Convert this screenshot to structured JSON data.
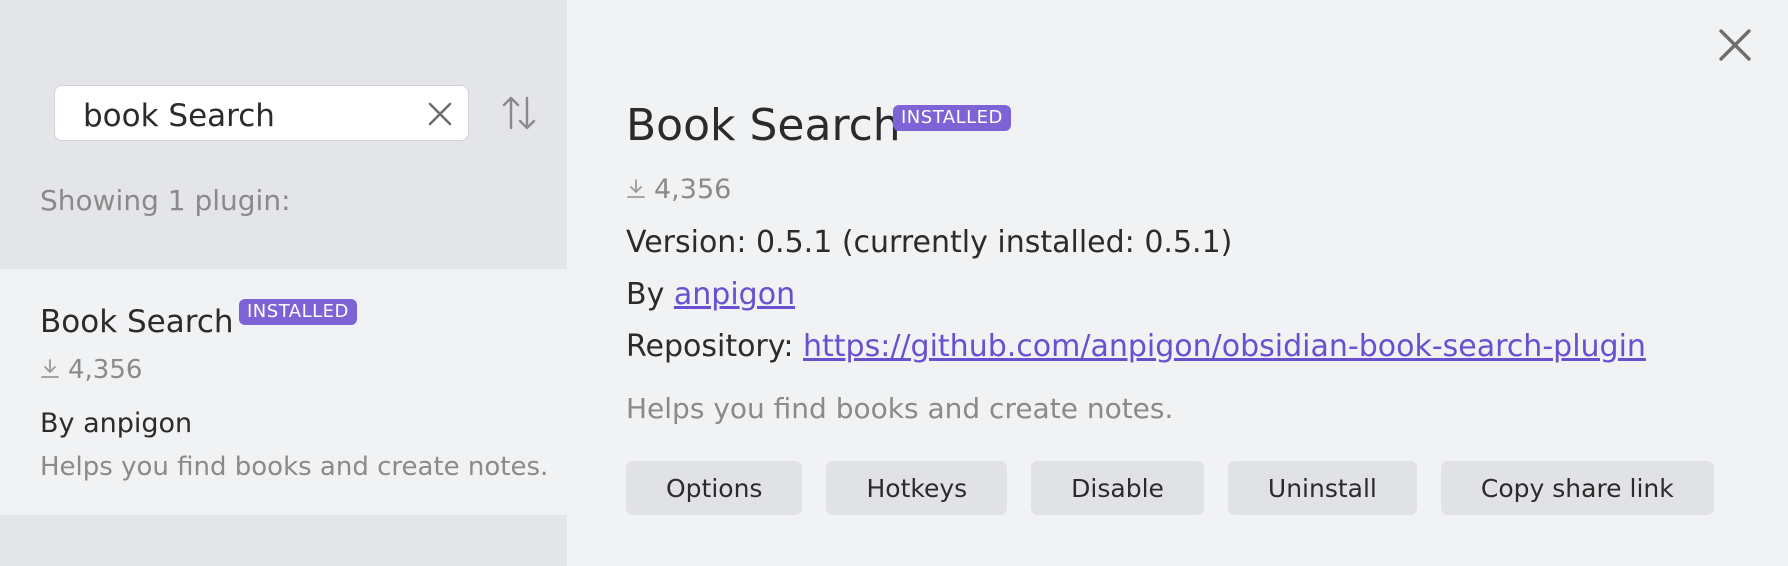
{
  "search": {
    "value": "book Search"
  },
  "results_info": "Showing 1 plugin:",
  "result": {
    "title": "Book Search",
    "badge": "INSTALLED",
    "downloads": "4,356",
    "author": "By anpigon",
    "description": "Helps you find books and create notes."
  },
  "detail": {
    "title": "Book Search",
    "badge": "INSTALLED",
    "downloads": "4,356",
    "version": "Version: 0.5.1 (currently installed: 0.5.1)",
    "author_prefix": "By",
    "author_name": "anpigon",
    "repo_prefix": "Repository:",
    "repo_url": "https://github.com/anpigon/obsidian-book-search-plugin",
    "description": "Helps you find books and create notes."
  },
  "buttons": {
    "options": "Options",
    "hotkeys": "Hotkeys",
    "disable": "Disable",
    "uninstall": "Uninstall",
    "copy_share_link": "Copy share link"
  },
  "icons": {
    "clear": "close-icon",
    "sort": "sort-icon",
    "download": "download-icon",
    "close_modal": "close-icon"
  },
  "colors": {
    "accent": "#7d63d6",
    "link": "#6a4fd0",
    "sidebar_bg": "#e4e5e8",
    "main_bg": "#f1f2f4"
  }
}
